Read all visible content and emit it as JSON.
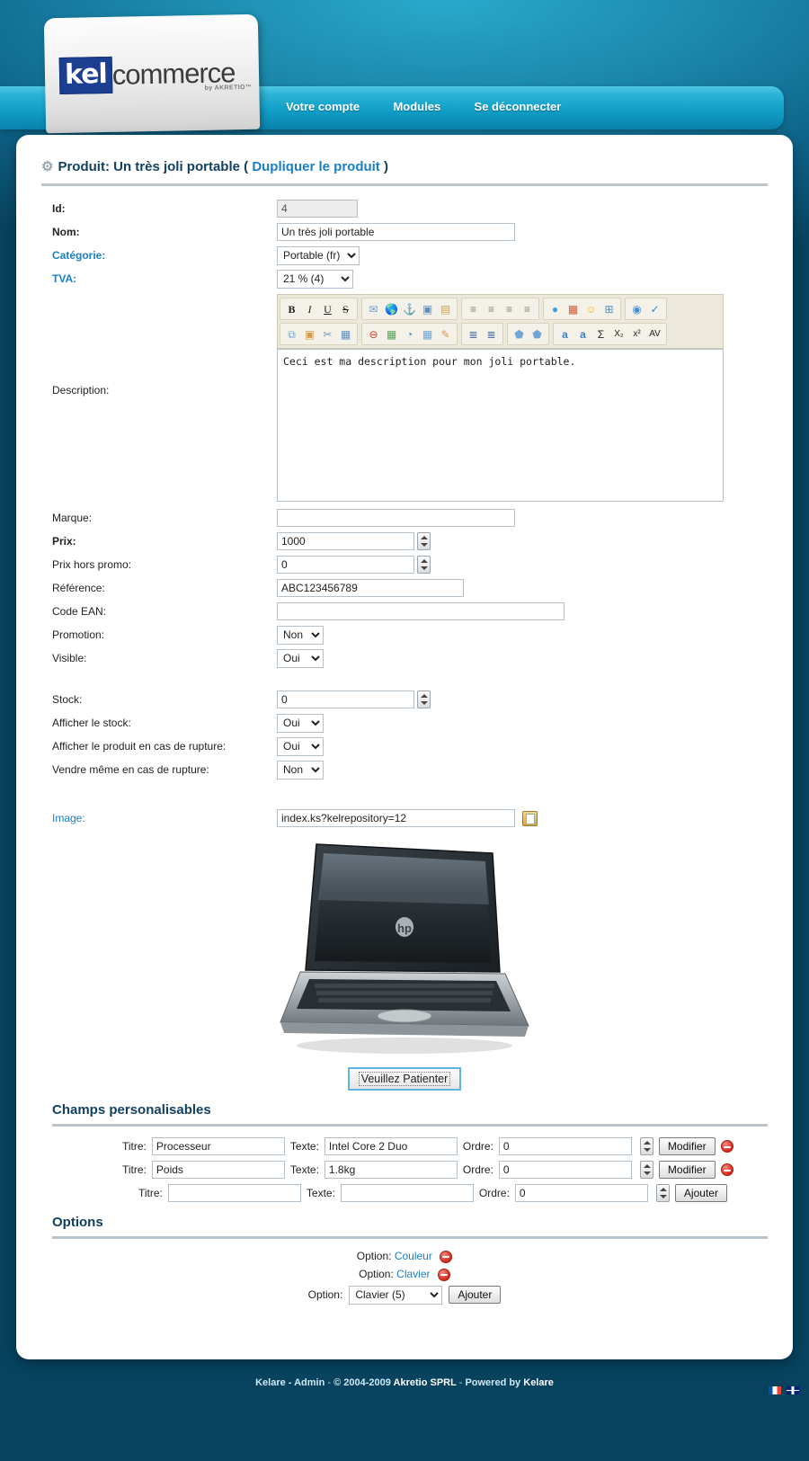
{
  "brand": {
    "logo_primary": "kel",
    "logo_secondary": "commerce",
    "logo_tagline": "by AKRETIO™"
  },
  "nav": {
    "items": [
      {
        "label": "Votre compte"
      },
      {
        "label": "Modules"
      },
      {
        "label": "Se déconnecter"
      }
    ]
  },
  "page": {
    "title_prefix": "Produit: Un très joli portable",
    "duplicate_open": "(",
    "duplicate_link": "Dupliquer le produit",
    "duplicate_close": ")"
  },
  "form": {
    "id": {
      "label": "Id:",
      "value": "4"
    },
    "nom": {
      "label": "Nom:",
      "value": "Un très joli portable"
    },
    "categorie": {
      "label": "Catégorie:",
      "value": "Portable (fr)"
    },
    "tva": {
      "label": "TVA:",
      "value": "21 % (4)"
    },
    "description": {
      "label": "Description:",
      "value": "Ceci est ma description pour mon joli portable."
    },
    "marque": {
      "label": "Marque:",
      "value": ""
    },
    "prix": {
      "label": "Prix:",
      "value": "1000"
    },
    "prix_hors_promo": {
      "label": "Prix hors promo:",
      "value": "0"
    },
    "reference": {
      "label": "Référence:",
      "value": "ABC123456789"
    },
    "code_ean": {
      "label": "Code EAN:",
      "value": ""
    },
    "promotion": {
      "label": "Promotion:",
      "value": "Non"
    },
    "visible": {
      "label": "Visible:",
      "value": "Oui"
    },
    "stock": {
      "label": "Stock:",
      "value": "0"
    },
    "afficher_stock": {
      "label": "Afficher le stock:",
      "value": "Oui"
    },
    "afficher_rupture": {
      "label": "Afficher le produit en cas de rupture:",
      "value": "Oui"
    },
    "vendre_rupture": {
      "label": "Vendre même en cas de rupture:",
      "value": "Non"
    },
    "image": {
      "label": "Image:",
      "value": "index.ks?kelrepository=12"
    }
  },
  "toolbar": {
    "row1": [
      {
        "group": "format",
        "buttons": [
          {
            "name": "bold-icon",
            "glyph": "B",
            "cls": "bold"
          },
          {
            "name": "italic-icon",
            "glyph": "I",
            "cls": "ital"
          },
          {
            "name": "underline-icon",
            "glyph": "U",
            "cls": "und"
          },
          {
            "name": "strikethrough-icon",
            "glyph": "S",
            "cls": "strk"
          }
        ]
      },
      {
        "group": "insert",
        "buttons": [
          {
            "name": "email-link-icon",
            "glyph": "✉",
            "color": "#6d9ed6"
          },
          {
            "name": "web-link-icon",
            "glyph": "●",
            "color": "#3f9b4f"
          },
          {
            "name": "anchor-icon",
            "glyph": "⚓",
            "color": "#555555"
          },
          {
            "name": "image-icon",
            "glyph": "■",
            "color": "#5b8fc9"
          },
          {
            "name": "flash-icon",
            "glyph": "▤",
            "color": "#e0a33a"
          }
        ]
      },
      {
        "group": "align",
        "buttons": [
          {
            "name": "align-left-icon",
            "glyph": "≡",
            "color": "#7d8a6a"
          },
          {
            "name": "align-center-icon",
            "glyph": "≡",
            "color": "#7d8a6a"
          },
          {
            "name": "align-right-icon",
            "glyph": "≡",
            "color": "#7d8a6a"
          },
          {
            "name": "align-justify-icon",
            "glyph": "≡",
            "color": "#7d8a6a"
          }
        ]
      },
      {
        "group": "style",
        "buttons": [
          {
            "name": "text-color-icon",
            "glyph": "●",
            "color": "#3da3d8"
          },
          {
            "name": "template-icon",
            "glyph": "▦",
            "color": "#cc5a3a"
          },
          {
            "name": "smiley-icon",
            "glyph": "☺",
            "color": "#e8b93c"
          },
          {
            "name": "insert-layer-icon",
            "glyph": "⊞",
            "color": "#4b8ec9"
          }
        ]
      },
      {
        "group": "tools",
        "buttons": [
          {
            "name": "preview-icon",
            "glyph": "◉",
            "color": "#4b8ec9"
          },
          {
            "name": "spellcheck-icon",
            "glyph": "✓",
            "color": "#2f7fc8"
          }
        ]
      }
    ],
    "row2": [
      {
        "group": "clipboard",
        "buttons": [
          {
            "name": "copy-icon",
            "glyph": "⧉",
            "color": "#6fa6d6"
          },
          {
            "name": "paste-icon",
            "glyph": "▣",
            "color": "#d39a4e"
          },
          {
            "name": "cut-icon",
            "glyph": "✂",
            "color": "#7a9ab8"
          },
          {
            "name": "select-all-icon",
            "glyph": "▦",
            "color": "#5b8fc9"
          }
        ]
      },
      {
        "group": "objects",
        "buttons": [
          {
            "name": "remove-format-icon",
            "glyph": "⊖",
            "color": "#d03a2c"
          },
          {
            "name": "calendar-icon",
            "glyph": "▦",
            "color": "#5ba35b"
          },
          {
            "name": "clock-icon",
            "glyph": "◔",
            "color": "#4b8ec9"
          },
          {
            "name": "table-icon",
            "glyph": "▦",
            "color": "#6fa6d6"
          },
          {
            "name": "edit-source-icon",
            "glyph": "✎",
            "color": "#d39a4e"
          }
        ]
      },
      {
        "group": "lists",
        "buttons": [
          {
            "name": "bullet-list-icon",
            "glyph": "≣",
            "color": "#4b6ea8"
          },
          {
            "name": "numbered-list-icon",
            "glyph": "≣",
            "color": "#4b6ea8"
          }
        ]
      },
      {
        "group": "comments",
        "buttons": [
          {
            "name": "add-comment-icon",
            "glyph": "⬟",
            "color": "#6fa6d6"
          },
          {
            "name": "delete-comment-icon",
            "glyph": "⬟",
            "color": "#6fa6d6"
          }
        ]
      },
      {
        "group": "typography",
        "buttons": [
          {
            "name": "font-color-icon",
            "glyph": "a",
            "color": "#3f7fc0"
          },
          {
            "name": "font-background-icon",
            "glyph": "a",
            "color": "#3f7fc0"
          },
          {
            "name": "symbol-icon",
            "glyph": "Σ",
            "color": "#222222"
          },
          {
            "name": "subscript-icon",
            "glyph": "X₂",
            "color": "#222222"
          },
          {
            "name": "superscript-icon",
            "glyph": "x²",
            "color": "#222222"
          },
          {
            "name": "kerning-icon",
            "glyph": "AV",
            "color": "#222222"
          }
        ]
      }
    ]
  },
  "image_actions": {
    "browse_icon": "repository-browse-icon",
    "wait_button": "Veuillez Patienter"
  },
  "custom_fields": {
    "heading": "Champs personalisables",
    "labels": {
      "titre": "Titre:",
      "texte": "Texte:",
      "ordre": "Ordre:"
    },
    "rows": [
      {
        "titre": "Processeur",
        "texte": "Intel Core 2 Duo",
        "ordre": "0",
        "button": "Modifier",
        "has_delete": true
      },
      {
        "titre": "Poids",
        "texte": "1.8kg",
        "ordre": "0",
        "button": "Modifier",
        "has_delete": true
      },
      {
        "titre": "",
        "texte": "",
        "ordre": "0",
        "button": "Ajouter",
        "has_delete": false
      }
    ]
  },
  "options": {
    "heading": "Options",
    "label": "Option:",
    "items": [
      {
        "name": "Couleur"
      },
      {
        "name": "Clavier"
      }
    ],
    "add_select_value": "Clavier (5)",
    "add_button": "Ajouter"
  },
  "footer": {
    "app": "Kelare - Admin",
    "sep1": "-",
    "copyright": "© 2004-2009",
    "company": "Akretio SPRL",
    "sep2": "-",
    "powered_prefix": "Powered by",
    "powered_by": "Kelare"
  },
  "colors": {
    "brand_blue": "#1c3f91",
    "header_cyan": "#2ab2d6",
    "link_blue": "#1a7fc1",
    "heading_navy": "#12415f",
    "page_bg": "#0c5f80"
  }
}
